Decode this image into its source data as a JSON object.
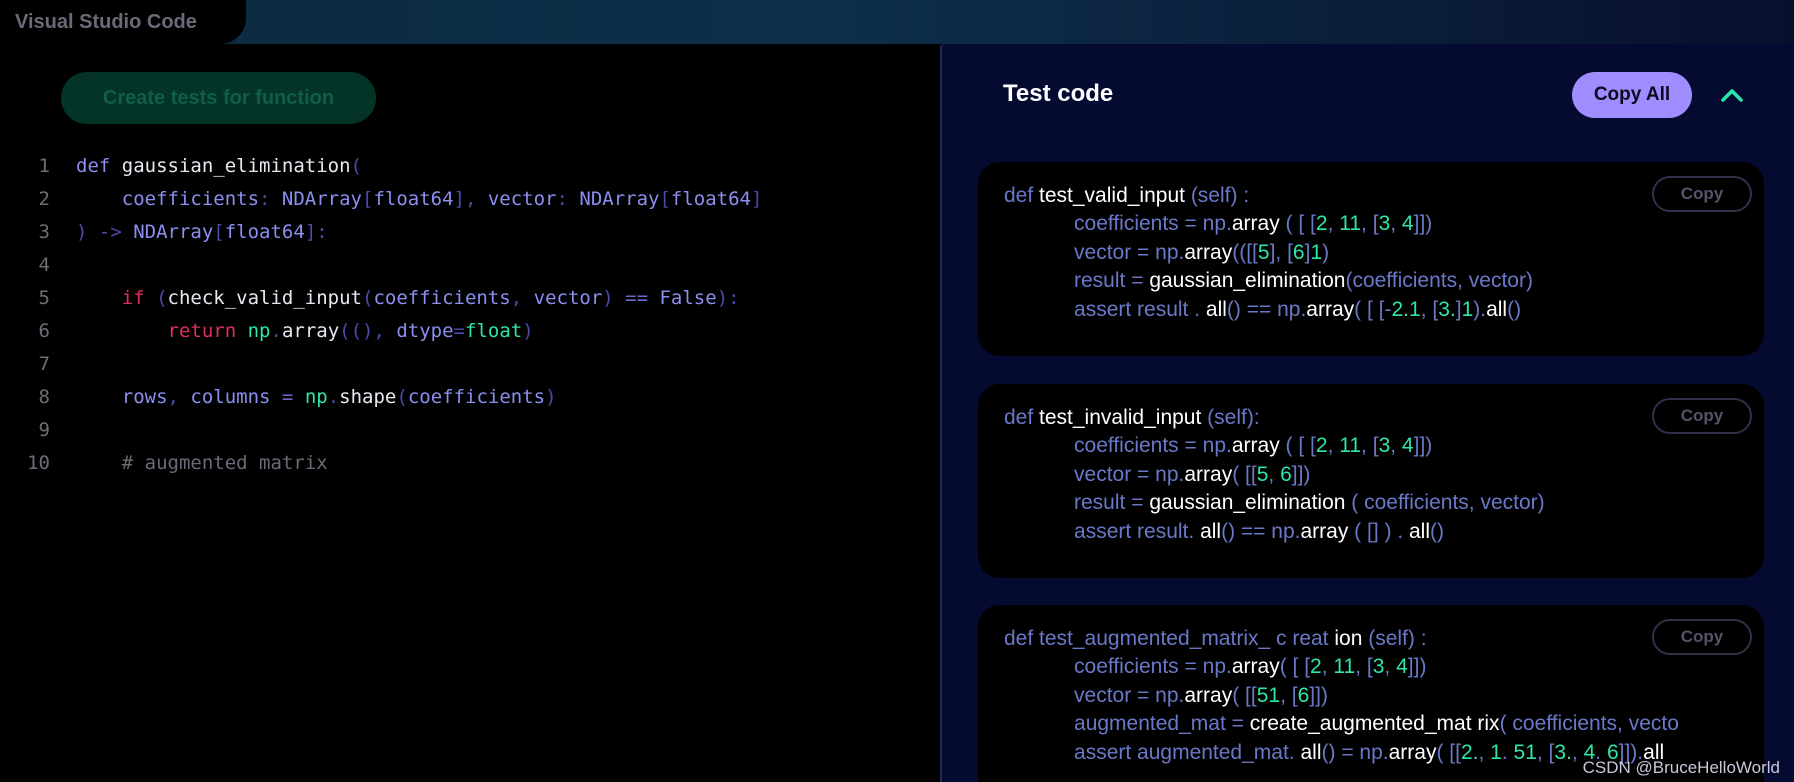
{
  "app": {
    "title": "Visual Studio Code"
  },
  "editor": {
    "generate_button": "Create tests for function",
    "lines": [
      {
        "num": "1",
        "tokens": [
          [
            "kw",
            "def "
          ],
          [
            "fn",
            "gaussian_elimination"
          ],
          [
            "pu",
            "("
          ]
        ]
      },
      {
        "num": "2",
        "tokens": [
          [
            "kw",
            "    coefficients"
          ],
          [
            "pu",
            ": "
          ],
          [
            "ty",
            "NDArray"
          ],
          [
            "pu",
            "["
          ],
          [
            "ty",
            "float64"
          ],
          [
            "pu",
            "], "
          ],
          [
            "kw",
            "vector"
          ],
          [
            "pu",
            ": "
          ],
          [
            "ty",
            "NDArray"
          ],
          [
            "pu",
            "["
          ],
          [
            "ty",
            "float64"
          ],
          [
            "pu",
            "]"
          ]
        ]
      },
      {
        "num": "3",
        "tokens": [
          [
            "pu",
            ") -> "
          ],
          [
            "ty",
            "NDArray"
          ],
          [
            "pu",
            "["
          ],
          [
            "ty",
            "float64"
          ],
          [
            "pu",
            "]:"
          ]
        ]
      },
      {
        "num": "4",
        "tokens": []
      },
      {
        "num": "5",
        "tokens": [
          [
            "rd",
            "    if "
          ],
          [
            "pu",
            "("
          ],
          [
            "fn",
            "check_valid_input"
          ],
          [
            "pu",
            "("
          ],
          [
            "kw",
            "coefficients"
          ],
          [
            "pu",
            ", "
          ],
          [
            "kw",
            "vector"
          ],
          [
            "pu",
            ") "
          ],
          [
            "op",
            "== "
          ],
          [
            "kw",
            "False"
          ],
          [
            "pu",
            "):"
          ]
        ]
      },
      {
        "num": "6",
        "tokens": [
          [
            "rd",
            "        return "
          ],
          [
            "gr",
            "np"
          ],
          [
            "pu",
            "."
          ],
          [
            "fn",
            "array"
          ],
          [
            "pu",
            "((), "
          ],
          [
            "kw",
            "dtype"
          ],
          [
            "pu",
            "="
          ],
          [
            "gr",
            "float"
          ],
          [
            "pu",
            ")"
          ]
        ]
      },
      {
        "num": "7",
        "tokens": []
      },
      {
        "num": "8",
        "tokens": [
          [
            "kw",
            "    rows"
          ],
          [
            "pu",
            ", "
          ],
          [
            "kw",
            "columns "
          ],
          [
            "op",
            "= "
          ],
          [
            "gr",
            "np"
          ],
          [
            "pu",
            "."
          ],
          [
            "fn",
            "shape"
          ],
          [
            "pu",
            "("
          ],
          [
            "kw",
            "coefficients"
          ],
          [
            "pu",
            ")"
          ]
        ]
      },
      {
        "num": "9",
        "tokens": []
      },
      {
        "num": "10",
        "tokens": [
          [
            "cm",
            "    # augmented matrix"
          ]
        ]
      }
    ]
  },
  "panel": {
    "title": "Test code",
    "copy_all": "Copy All",
    "collapse_icon": "chevron-up-icon",
    "cards": [
      {
        "copy_label": "Copy",
        "lines": [
          [
            [
              "t",
              "def "
            ],
            [
              "w",
              "test_valid_input "
            ],
            [
              "t",
              "(self) :"
            ]
          ],
          [
            [
              "t",
              "            coefficients "
            ],
            [
              "t",
              "= "
            ],
            [
              "t",
              "np."
            ],
            [
              "w",
              "array "
            ],
            [
              "t",
              "( [ ["
            ],
            [
              "g",
              "2"
            ],
            [
              "t",
              ", "
            ],
            [
              "g",
              "11"
            ],
            [
              "t",
              ", ["
            ],
            [
              "g",
              "3"
            ],
            [
              "t",
              ", "
            ],
            [
              "g",
              "4"
            ],
            [
              "t",
              "]])"
            ]
          ],
          [
            [
              "t",
              "            vector "
            ],
            [
              "t",
              "= "
            ],
            [
              "t",
              "np."
            ],
            [
              "w",
              "array"
            ],
            [
              "t",
              "(([["
            ],
            [
              "g",
              "5"
            ],
            [
              "t",
              "], ["
            ],
            [
              "g",
              "6"
            ],
            [
              "t",
              "]"
            ],
            [
              "g",
              "1"
            ],
            [
              "t",
              ")"
            ]
          ],
          [
            [
              "t",
              "            result "
            ],
            [
              "t",
              "= "
            ],
            [
              "w",
              "gaussian_elimination"
            ],
            [
              "t",
              "(coefficients, vector)"
            ]
          ],
          [
            [
              "t",
              "            assert result . "
            ],
            [
              "w",
              "all"
            ],
            [
              "t",
              "() == np."
            ],
            [
              "w",
              "array"
            ],
            [
              "t",
              "( [ [-"
            ],
            [
              "g",
              "2.1"
            ],
            [
              "t",
              ", ["
            ],
            [
              "g",
              "3."
            ],
            [
              "t",
              "]"
            ],
            [
              "g",
              "1"
            ],
            [
              "t",
              ")."
            ],
            [
              "w",
              "all"
            ],
            [
              "t",
              "()"
            ]
          ]
        ]
      },
      {
        "copy_label": "Copy",
        "lines": [
          [
            [
              "t",
              "def "
            ],
            [
              "w",
              "test_invalid_input "
            ],
            [
              "t",
              "(self):"
            ]
          ],
          [
            [
              "t",
              "            coefficients "
            ],
            [
              "t",
              "= "
            ],
            [
              "t",
              "np."
            ],
            [
              "w",
              "array "
            ],
            [
              "t",
              "( [ ["
            ],
            [
              "g",
              "2"
            ],
            [
              "t",
              ", "
            ],
            [
              "g",
              "11"
            ],
            [
              "t",
              ", ["
            ],
            [
              "g",
              "3"
            ],
            [
              "t",
              ", "
            ],
            [
              "g",
              "4"
            ],
            [
              "t",
              "]])"
            ]
          ],
          [
            [
              "t",
              "            vector "
            ],
            [
              "t",
              "= "
            ],
            [
              "t",
              "np."
            ],
            [
              "w",
              "array"
            ],
            [
              "t",
              "( [["
            ],
            [
              "g",
              "5"
            ],
            [
              "t",
              ", "
            ],
            [
              "g",
              "6"
            ],
            [
              "t",
              "]])"
            ]
          ],
          [
            [
              "t",
              "            result "
            ],
            [
              "t",
              "= "
            ],
            [
              "w",
              "gaussian_elimination "
            ],
            [
              "t",
              "( coefficients, vector)"
            ]
          ],
          [
            [
              "t",
              "            assert result. "
            ],
            [
              "w",
              "all"
            ],
            [
              "t",
              "() == np."
            ],
            [
              "w",
              "array "
            ],
            [
              "t",
              "( [] ) . "
            ],
            [
              "w",
              "all"
            ],
            [
              "t",
              "()"
            ]
          ]
        ]
      },
      {
        "copy_label": "Copy",
        "lines": [
          [
            [
              "t",
              "def test_augmented_matrix_ c reat "
            ],
            [
              "w",
              "ion "
            ],
            [
              "t",
              "(self) :"
            ]
          ],
          [
            [
              "t",
              "            coefficients "
            ],
            [
              "t",
              "= "
            ],
            [
              "t",
              "np."
            ],
            [
              "w",
              "array"
            ],
            [
              "t",
              "( [ ["
            ],
            [
              "g",
              "2"
            ],
            [
              "t",
              ", "
            ],
            [
              "g",
              "11"
            ],
            [
              "t",
              ", ["
            ],
            [
              "g",
              "3"
            ],
            [
              "t",
              ", "
            ],
            [
              "g",
              "4"
            ],
            [
              "t",
              "]])"
            ]
          ],
          [
            [
              "t",
              "            vector "
            ],
            [
              "t",
              "= "
            ],
            [
              "t",
              "np."
            ],
            [
              "w",
              "array"
            ],
            [
              "t",
              "( [["
            ],
            [
              "g",
              "51"
            ],
            [
              "t",
              ", ["
            ],
            [
              "g",
              "6"
            ],
            [
              "t",
              "]])"
            ]
          ],
          [
            [
              "t",
              "            augmented_mat "
            ],
            [
              "t",
              "= "
            ],
            [
              "w",
              "create_augmented_mat "
            ],
            [
              "w",
              "rix"
            ],
            [
              "t",
              "( coefficients, vecto"
            ]
          ],
          [
            [
              "t",
              "            assert augmented_mat. "
            ],
            [
              "w",
              "all"
            ],
            [
              "t",
              "() = np."
            ],
            [
              "w",
              "array"
            ],
            [
              "t",
              "( [["
            ],
            [
              "g",
              "2."
            ],
            [
              "t",
              ", "
            ],
            [
              "g",
              "1"
            ],
            [
              "t",
              ". "
            ],
            [
              "g",
              "51"
            ],
            [
              "t",
              ", ["
            ],
            [
              "g",
              "3."
            ],
            [
              "t",
              ", "
            ],
            [
              "g",
              "4"
            ],
            [
              "t",
              ". "
            ],
            [
              "g",
              "6"
            ],
            [
              "t",
              "]])."
            ],
            [
              "w",
              "all"
            ]
          ]
        ]
      }
    ]
  },
  "watermark": "CSDN @BruceHelloWorld"
}
